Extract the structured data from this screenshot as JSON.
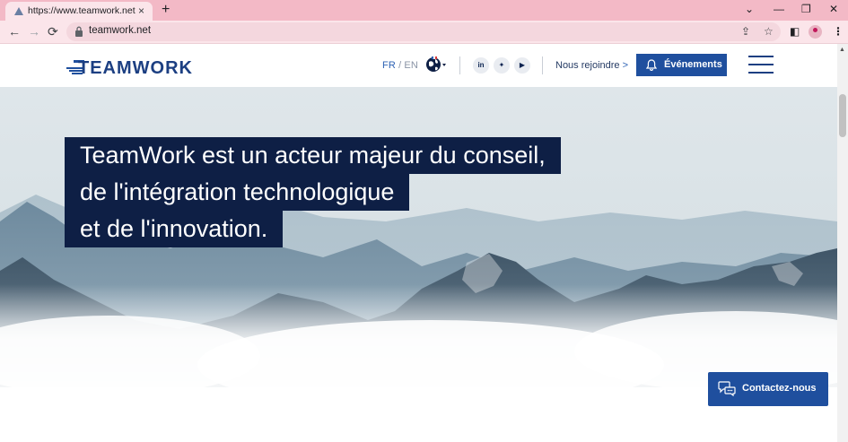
{
  "browser": {
    "tab_title": "https://www.teamwork.net",
    "tab_close": "×",
    "new_tab": "+",
    "url": "teamwork.net",
    "nav": {
      "back": "←",
      "forward": "→",
      "reload": "⟳"
    },
    "window_controls": {
      "chevron": "⌄",
      "minimize": "—",
      "restore": "❐",
      "close": "✕"
    }
  },
  "header": {
    "brand": "TEAMWORK",
    "lang": {
      "fr": "FR",
      "sep": "/",
      "en": "EN"
    },
    "social": [
      {
        "name": "linkedin",
        "glyph": "in"
      },
      {
        "name": "twitter",
        "glyph": "✦"
      },
      {
        "name": "youtube",
        "glyph": "▶"
      }
    ],
    "join_label": "Nous rejoindre",
    "join_arrow": ">",
    "events_label": "Événements"
  },
  "hero": {
    "headline_lines": [
      "TeamWork est un acteur majeur du conseil,",
      "de l'intégration technologique",
      "et de l'innovation."
    ],
    "contact_label": "Contactez-nous"
  },
  "colors": {
    "tabstrip": "#f3b9c6",
    "toolbar": "#fbe5ea",
    "brand_navy": "#0e1f45",
    "button_blue": "#1f4f9e"
  }
}
